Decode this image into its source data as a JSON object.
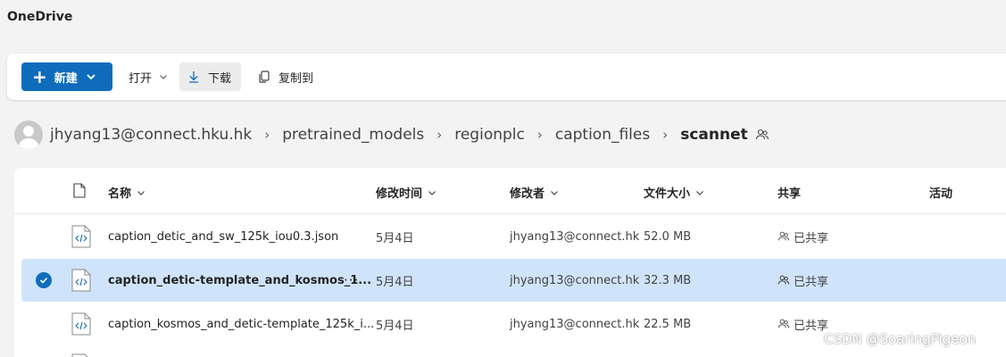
{
  "app": {
    "title": "OneDrive"
  },
  "toolbar": {
    "new_label": "新建",
    "open_label": "打开",
    "download_label": "下载",
    "copy_label": "复制到"
  },
  "breadcrumb": {
    "items": [
      "jhyang13@connect.hku.hk",
      "pretrained_models",
      "regionplc",
      "caption_files"
    ],
    "current": "scannet"
  },
  "columns": {
    "name": "名称",
    "modified": "修改时间",
    "modified_by": "修改者",
    "size": "文件大小",
    "sharing": "共享",
    "activity": "活动"
  },
  "files": [
    {
      "name": "caption_detic_and_sw_125k_iou0.3.json",
      "modified": "5月4日",
      "modified_by": "jhyang13@connect.hk",
      "size": "52.0 MB",
      "sharing": "已共享",
      "selected": false
    },
    {
      "name": "caption_detic-template_and_kosmos_1...",
      "modified": "5月4日",
      "modified_by": "jhyang13@connect.hk",
      "size": "32.3 MB",
      "sharing": "已共享",
      "selected": true
    },
    {
      "name": "caption_kosmos_and_detic-template_125k_i...",
      "modified": "5月4日",
      "modified_by": "jhyang13@connect.hk",
      "size": "22.5 MB",
      "sharing": "已共享",
      "selected": false
    }
  ],
  "more_label": "···",
  "watermark": "CSDN @SoaringPigeon",
  "colors": {
    "accent": "#0f6cbd",
    "selected_row": "#cfe4fa",
    "background": "#f3f3f3"
  }
}
